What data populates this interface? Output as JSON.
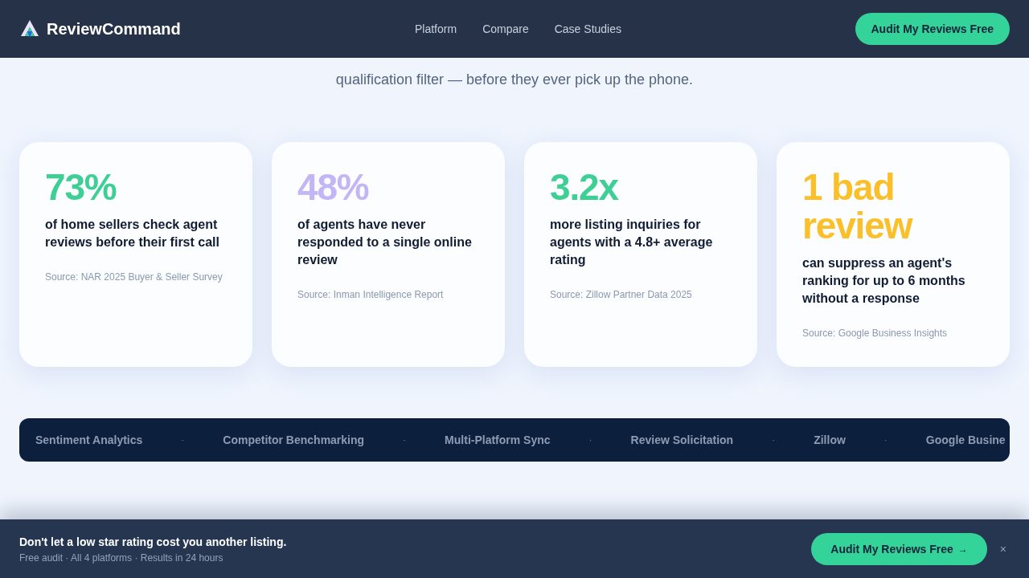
{
  "header": {
    "brand": "ReviewCommand",
    "nav": [
      "Platform",
      "Compare",
      "Case Studies"
    ],
    "cta": "Audit My Reviews Free"
  },
  "intro": "qualification filter — before they ever pick up the phone.",
  "stats": [
    {
      "value": "73%",
      "color": "#3ecf95",
      "text": "of home sellers check agent reviews before their first call",
      "source": "Source: NAR 2025 Buyer & Seller Survey"
    },
    {
      "value": "48%",
      "color": "#c4b5f7",
      "text": "of agents have never responded to a single online review",
      "source": "Source: Inman Intelligence Report"
    },
    {
      "value": "3.2x",
      "color": "#3ecf95",
      "text": "more listing inquiries for agents with a 4.8+ average rating",
      "source": "Source: Zillow Partner Data 2025"
    },
    {
      "value": "1 bad review",
      "color": "#fbbf2a",
      "text": "can suppress an agent's ranking for up to 6 months without a response",
      "source": "Source: Google Business Insights"
    }
  ],
  "ticker": [
    {
      "kind": "label",
      "text": "Sentiment Analytics"
    },
    {
      "kind": "separator",
      "text": "·"
    },
    {
      "kind": "label",
      "text": "Competitor Benchmarking"
    },
    {
      "kind": "separator",
      "text": "·"
    },
    {
      "kind": "label",
      "text": "Multi-Platform Sync"
    },
    {
      "kind": "separator",
      "text": "·"
    },
    {
      "kind": "label",
      "text": "Review Solicitation"
    },
    {
      "kind": "separator",
      "text": "·"
    },
    {
      "kind": "label",
      "text": "Zillow"
    },
    {
      "kind": "separator",
      "text": "·"
    },
    {
      "kind": "label",
      "text": "Google Busine"
    }
  ],
  "banner": {
    "title": "Don't let a low star rating cost you another listing.",
    "subtitle": "Free audit · All 4 platforms · Results in 24 hours",
    "cta": "Audit My Reviews Free",
    "arrow": "→",
    "close": "×"
  }
}
